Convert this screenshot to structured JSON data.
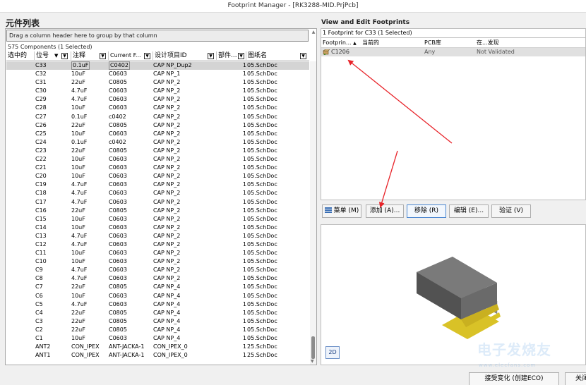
{
  "window": {
    "title": "Footprint Manager - [RK3288-MID.PrjPcb]"
  },
  "left": {
    "title": "元件列表",
    "group_bar": "Drag a column header here to group by that column",
    "count": "575 Components (1 Selected)",
    "columns": [
      "选中的",
      "位号",
      "注释",
      "Current F...",
      "设计项目ID",
      "部件...",
      "图纸名"
    ],
    "rows": [
      [
        "C33",
        "0.1uF",
        "C0402",
        "CAP NP_Dup2",
        "1",
        "05.SchDoc"
      ],
      [
        "C32",
        "10uF",
        "C0603",
        "CAP NP_1",
        "1",
        "05.SchDoc"
      ],
      [
        "C31",
        "22uF",
        "C0805",
        "CAP NP_2",
        "1",
        "05.SchDoc"
      ],
      [
        "C30",
        "4.7uF",
        "C0603",
        "CAP NP_2",
        "1",
        "05.SchDoc"
      ],
      [
        "C29",
        "4.7uF",
        "C0603",
        "CAP NP_2",
        "1",
        "05.SchDoc"
      ],
      [
        "C28",
        "10uF",
        "C0603",
        "CAP NP_2",
        "1",
        "05.SchDoc"
      ],
      [
        "C27",
        "0.1uF",
        "c0402",
        "CAP NP_2",
        "1",
        "05.SchDoc"
      ],
      [
        "C26",
        "22uF",
        "C0805",
        "CAP NP_2",
        "1",
        "05.SchDoc"
      ],
      [
        "C25",
        "10uF",
        "C0603",
        "CAP NP_2",
        "1",
        "05.SchDoc"
      ],
      [
        "C24",
        "0.1uF",
        "c0402",
        "CAP NP_2",
        "1",
        "05.SchDoc"
      ],
      [
        "C23",
        "22uF",
        "C0805",
        "CAP NP_2",
        "1",
        "05.SchDoc"
      ],
      [
        "C22",
        "10uF",
        "C0603",
        "CAP NP_2",
        "1",
        "05.SchDoc"
      ],
      [
        "C21",
        "10uF",
        "C0603",
        "CAP NP_2",
        "1",
        "05.SchDoc"
      ],
      [
        "C20",
        "10uF",
        "C0603",
        "CAP NP_2",
        "1",
        "05.SchDoc"
      ],
      [
        "C19",
        "4.7uF",
        "C0603",
        "CAP NP_2",
        "1",
        "05.SchDoc"
      ],
      [
        "C18",
        "4.7uF",
        "C0603",
        "CAP NP_2",
        "1",
        "05.SchDoc"
      ],
      [
        "C17",
        "4.7uF",
        "C0603",
        "CAP NP_2",
        "1",
        "05.SchDoc"
      ],
      [
        "C16",
        "22uF",
        "C0805",
        "CAP NP_2",
        "1",
        "05.SchDoc"
      ],
      [
        "C15",
        "10uF",
        "C0603",
        "CAP NP_2",
        "1",
        "05.SchDoc"
      ],
      [
        "C14",
        "10uF",
        "C0603",
        "CAP NP_2",
        "1",
        "05.SchDoc"
      ],
      [
        "C13",
        "4.7uF",
        "C0603",
        "CAP NP_2",
        "1",
        "05.SchDoc"
      ],
      [
        "C12",
        "4.7uF",
        "C0603",
        "CAP NP_2",
        "1",
        "05.SchDoc"
      ],
      [
        "C11",
        "10uF",
        "C0603",
        "CAP NP_2",
        "1",
        "05.SchDoc"
      ],
      [
        "C10",
        "10uF",
        "C0603",
        "CAP NP_2",
        "1",
        "05.SchDoc"
      ],
      [
        "C9",
        "4.7uF",
        "C0603",
        "CAP NP_2",
        "1",
        "05.SchDoc"
      ],
      [
        "C8",
        "4.7uF",
        "C0603",
        "CAP NP_2",
        "1",
        "05.SchDoc"
      ],
      [
        "C7",
        "22uF",
        "C0805",
        "CAP NP_4",
        "1",
        "05.SchDoc"
      ],
      [
        "C6",
        "10uF",
        "C0603",
        "CAP NP_4",
        "1",
        "05.SchDoc"
      ],
      [
        "C5",
        "4.7uF",
        "C0603",
        "CAP NP_4",
        "1",
        "05.SchDoc"
      ],
      [
        "C4",
        "22uF",
        "C0805",
        "CAP NP_4",
        "1",
        "05.SchDoc"
      ],
      [
        "C3",
        "22uF",
        "C0805",
        "CAP NP_4",
        "1",
        "05.SchDoc"
      ],
      [
        "C2",
        "22uF",
        "C0805",
        "CAP NP_4",
        "1",
        "05.SchDoc"
      ],
      [
        "C1",
        "10uF",
        "C0603",
        "CAP NP_4",
        "1",
        "05.SchDoc"
      ],
      [
        "ANT2",
        "CON_IPEX",
        "ANT-JACKA-1",
        "CON_IPEX_0",
        "1",
        "25.SchDoc"
      ],
      [
        "ANT1",
        "CON_IPEX",
        "ANT-JACKA-1",
        "CON_IPEX_0",
        "1",
        "25.SchDoc"
      ]
    ]
  },
  "right": {
    "title": "View and Edit Footprints",
    "count": "1 Footprint for C33 (1 Selected)",
    "columns": [
      "Footprin...",
      "当前的",
      "PCB库",
      "在...发现"
    ],
    "footprint": {
      "name": "C1206",
      "library": "Any",
      "status": "Not Validated"
    },
    "buttons": {
      "menu": "菜单 (M)",
      "add": "添加 (A)...",
      "remove": "移除 (R)",
      "edit": "编辑 (E)...",
      "validate": "验证 (V)"
    },
    "view_2d": "2D"
  },
  "footer": {
    "accept": "接受变化 (创建ECO)",
    "close": "关闭"
  },
  "watermark": {
    "text": "电子发烧友",
    "sub": "www.elecfans.com"
  },
  "colors": {
    "selection": "#d4d4d4",
    "arrow": "#e8242a",
    "pad": "#d9c227",
    "body": "#6f6f6f"
  }
}
